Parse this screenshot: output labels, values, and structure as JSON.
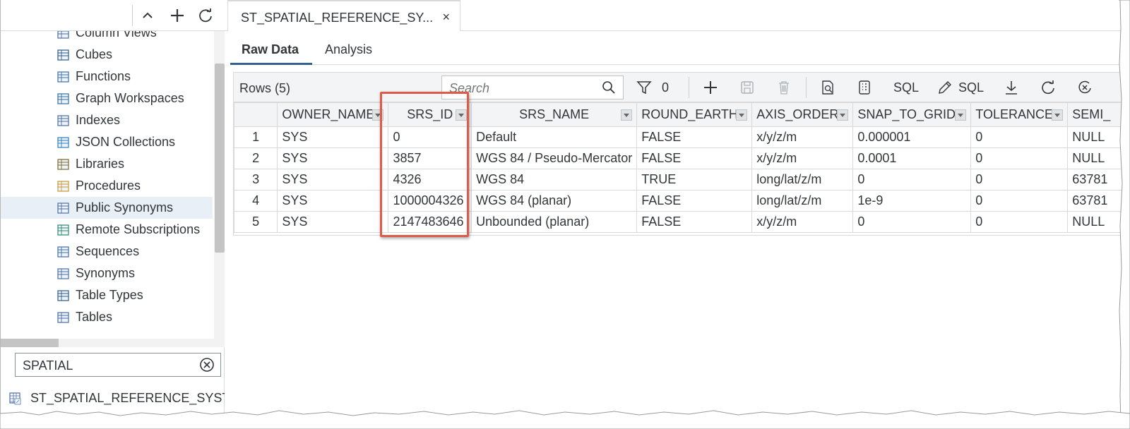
{
  "left_panel": {
    "tree_items": [
      {
        "label": "Column Views",
        "icon": "column-view-icon"
      },
      {
        "label": "Cubes",
        "icon": "cube-icon"
      },
      {
        "label": "Functions",
        "icon": "function-icon"
      },
      {
        "label": "Graph Workspaces",
        "icon": "graph-icon"
      },
      {
        "label": "Indexes",
        "icon": "index-icon"
      },
      {
        "label": "JSON Collections",
        "icon": "json-collection-icon"
      },
      {
        "label": "Libraries",
        "icon": "library-icon"
      },
      {
        "label": "Procedures",
        "icon": "procedure-icon"
      },
      {
        "label": "Public Synonyms",
        "icon": "public-synonym-icon",
        "selected": true
      },
      {
        "label": "Remote Subscriptions",
        "icon": "remote-subscription-icon"
      },
      {
        "label": "Sequences",
        "icon": "sequence-icon"
      },
      {
        "label": "Synonyms",
        "icon": "synonym-icon"
      },
      {
        "label": "Table Types",
        "icon": "table-type-icon"
      },
      {
        "label": "Tables",
        "icon": "table-icon"
      }
    ],
    "search_value": "SPATIAL",
    "result_item": "ST_SPATIAL_REFERENCE_SYSTE"
  },
  "doc_tab": {
    "label": "ST_SPATIAL_REFERENCE_SY...",
    "close": "×"
  },
  "sub_tabs": [
    {
      "label": "Raw Data",
      "active": true
    },
    {
      "label": "Analysis",
      "active": false
    }
  ],
  "grid": {
    "rows_label": "Rows (5)",
    "search_placeholder": "Search",
    "filter_count": "0",
    "sql_label_1": "SQL",
    "sql_label_2": "SQL",
    "columns": [
      "",
      "OWNER_NAME",
      "SRS_ID",
      "SRS_NAME",
      "ROUND_EARTH",
      "AXIS_ORDER",
      "SNAP_TO_GRID",
      "TOLERANCE",
      "SEMI_"
    ],
    "rows": [
      [
        "1",
        "SYS",
        "0",
        "Default",
        "FALSE",
        "x/y/z/m",
        "0.000001",
        "0",
        "NULL"
      ],
      [
        "2",
        "SYS",
        "3857",
        "WGS 84 / Pseudo-Mercator",
        "FALSE",
        "x/y/z/m",
        "0.0001",
        "0",
        "NULL"
      ],
      [
        "3",
        "SYS",
        "4326",
        "WGS 84",
        "TRUE",
        "long/lat/z/m",
        "0",
        "0",
        "63781"
      ],
      [
        "4",
        "SYS",
        "1000004326",
        "WGS 84 (planar)",
        "FALSE",
        "long/lat/z/m",
        "1e-9",
        "0",
        "63781"
      ],
      [
        "5",
        "SYS",
        "2147483646",
        "Unbounded (planar)",
        "FALSE",
        "x/y/z/m",
        "0",
        "0",
        "NULL"
      ]
    ]
  },
  "colors": {
    "highlight": "#e05a47",
    "active_tab_underline": "#32608f",
    "selected_row": "#e8eff6"
  }
}
